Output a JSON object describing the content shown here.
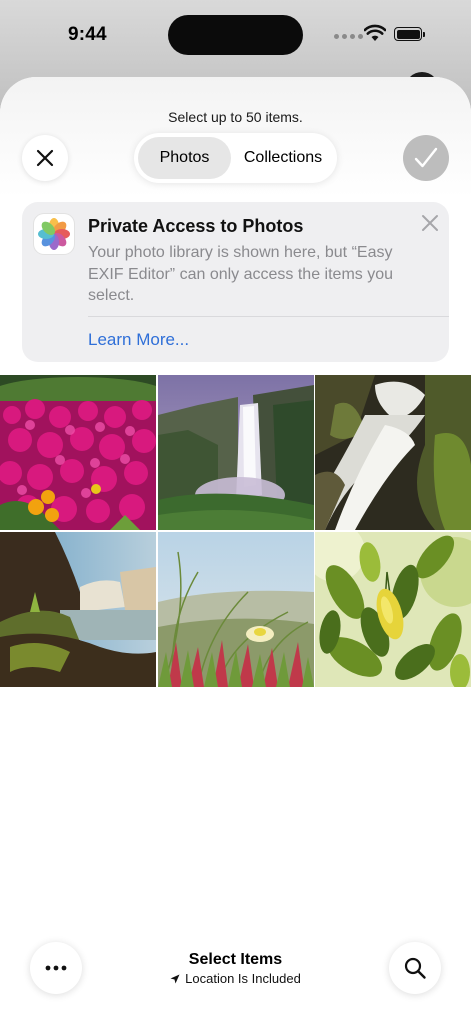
{
  "status_bar": {
    "time": "9:44"
  },
  "header": {
    "hint": "Select up to 50 items.",
    "tabs": [
      {
        "label": "Photos",
        "selected": true
      },
      {
        "label": "Collections",
        "selected": false
      }
    ]
  },
  "banner": {
    "title": "Private Access to Photos",
    "body": "Your photo library is shown here, but “Easy EXIF Editor” can only access the items you select.",
    "link": "Learn More..."
  },
  "photos": [
    {
      "name": "pink flowers"
    },
    {
      "name": "waterfall cliff"
    },
    {
      "name": "long exposure cascade"
    },
    {
      "name": "waterfall coast"
    },
    {
      "name": "grass with flower"
    },
    {
      "name": "lemon tree leaves"
    }
  ],
  "footer": {
    "title": "Select Items",
    "subtitle": "Location Is Included"
  },
  "colors": {
    "accent": "#2f6fd8",
    "done_disabled": "#bdbdbd"
  }
}
